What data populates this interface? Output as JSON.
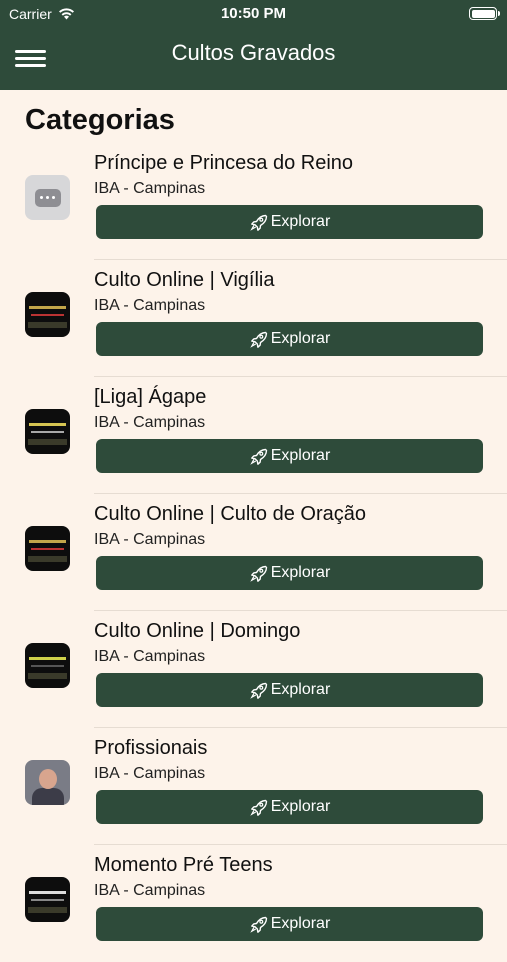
{
  "status": {
    "carrier": "Carrier",
    "time": "10:50 PM"
  },
  "header": {
    "title": "Cultos Gravados"
  },
  "section": {
    "title": "Categorias"
  },
  "colors": {
    "primary": "#2e4b3a",
    "background": "#fdf3ea"
  },
  "categories": [
    {
      "name": "Príncipe e Princesa do Reino",
      "subtitle": "IBA - Campinas",
      "action": "Explorar",
      "thumb": "placeholder-icon"
    },
    {
      "name": "Culto Online | Vigília",
      "subtitle": "IBA - Campinas",
      "action": "Explorar",
      "thumb": "video-thumbnail"
    },
    {
      "name": "[Liga] Ágape",
      "subtitle": "IBA - Campinas",
      "action": "Explorar",
      "thumb": "video-thumbnail"
    },
    {
      "name": "Culto Online | Culto de Oração",
      "subtitle": "IBA - Campinas",
      "action": "Explorar",
      "thumb": "video-thumbnail"
    },
    {
      "name": "Culto Online | Domingo",
      "subtitle": "IBA - Campinas",
      "action": "Explorar",
      "thumb": "video-thumbnail"
    },
    {
      "name": "Profissionais",
      "subtitle": "IBA - Campinas",
      "action": "Explorar",
      "thumb": "person-photo"
    },
    {
      "name": "Momento Pré Teens",
      "subtitle": "IBA - Campinas",
      "action": "Explorar",
      "thumb": "video-thumbnail"
    }
  ]
}
